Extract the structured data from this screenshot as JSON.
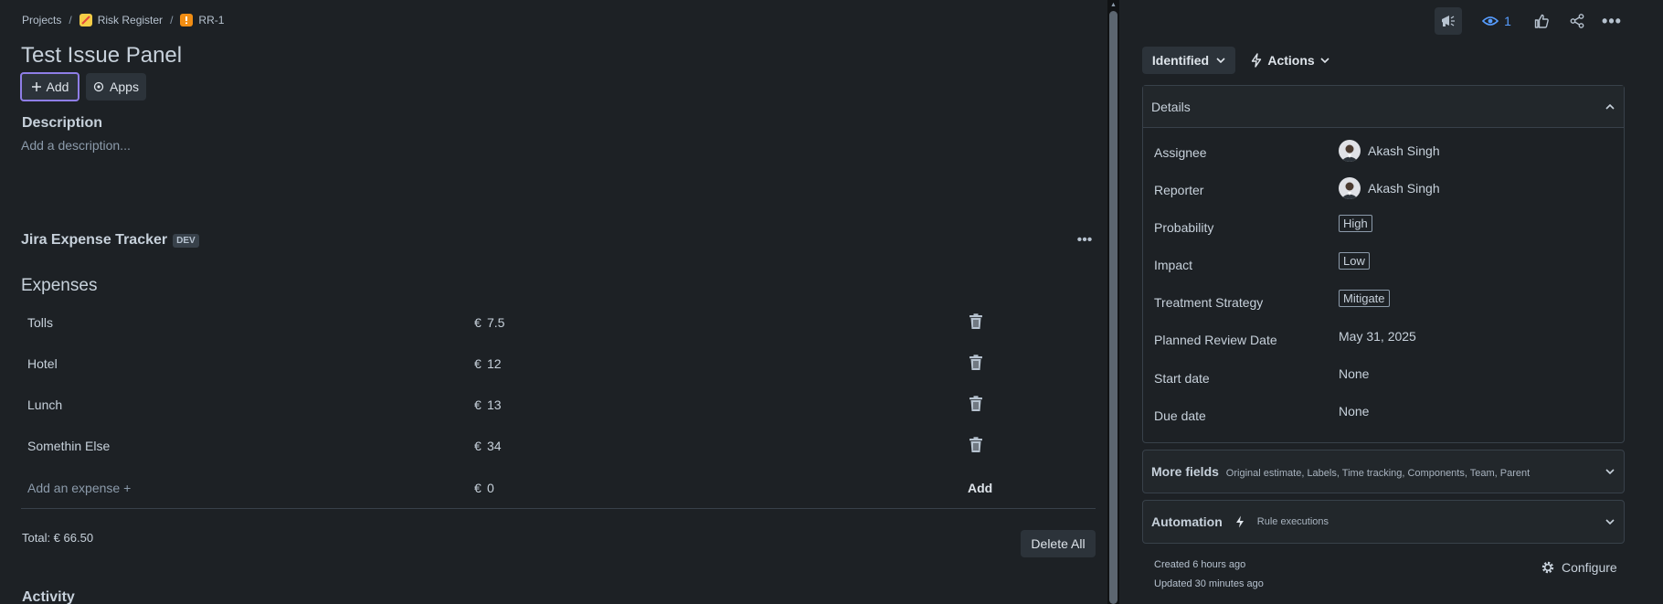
{
  "breadcrumb": {
    "projects": "Projects",
    "project": "Risk Register",
    "issue_key": "RR-1",
    "separator": "/"
  },
  "issue": {
    "title": "Test Issue Panel",
    "add_label": "Add",
    "apps_label": "Apps",
    "description_heading": "Description",
    "description_placeholder": "Add a description..."
  },
  "app_panel": {
    "title": "Jira Expense Tracker",
    "badge": "DEV",
    "more": "•••",
    "heading": "Expenses",
    "currency": "€",
    "expenses": [
      {
        "name": "Tolls",
        "amount": "7.5"
      },
      {
        "name": "Hotel",
        "amount": "12"
      },
      {
        "name": "Lunch",
        "amount": "13"
      },
      {
        "name": "Somethin Else",
        "amount": "34"
      }
    ],
    "new_expense": {
      "placeholder": "Add an expense +",
      "amount": "0",
      "add_label": "Add"
    },
    "total": "Total: € 66.50",
    "delete_all_label": "Delete All"
  },
  "activity_heading": "Activity",
  "sidebar": {
    "watch_count": "1",
    "more": "•••",
    "status": "Identified",
    "actions_label": "Actions",
    "details": {
      "heading": "Details",
      "fields": [
        {
          "label": "Assignee",
          "value": "Akash Singh"
        },
        {
          "label": "Reporter",
          "value": "Akash Singh"
        },
        {
          "label": "Probability",
          "value": "High"
        },
        {
          "label": "Impact",
          "value": "Low"
        },
        {
          "label": "Treatment Strategy",
          "value": "Mitigate"
        },
        {
          "label": "Planned Review Date",
          "value": "May 31, 2025"
        },
        {
          "label": "Start date",
          "value": "None"
        },
        {
          "label": "Due date",
          "value": "None"
        }
      ]
    },
    "more_fields": {
      "heading": "More fields",
      "summary": "Original estimate, Labels, Time tracking, Components, Team, Parent"
    },
    "automation": {
      "heading": "Automation",
      "summary": "Rule executions"
    },
    "created": "Created 6 hours ago",
    "updated": "Updated 30 minutes ago",
    "configure_label": "Configure"
  },
  "colors": {
    "background": "#1d2125",
    "accent_focus": "#8f7ee7",
    "link_blue": "#579dff"
  }
}
